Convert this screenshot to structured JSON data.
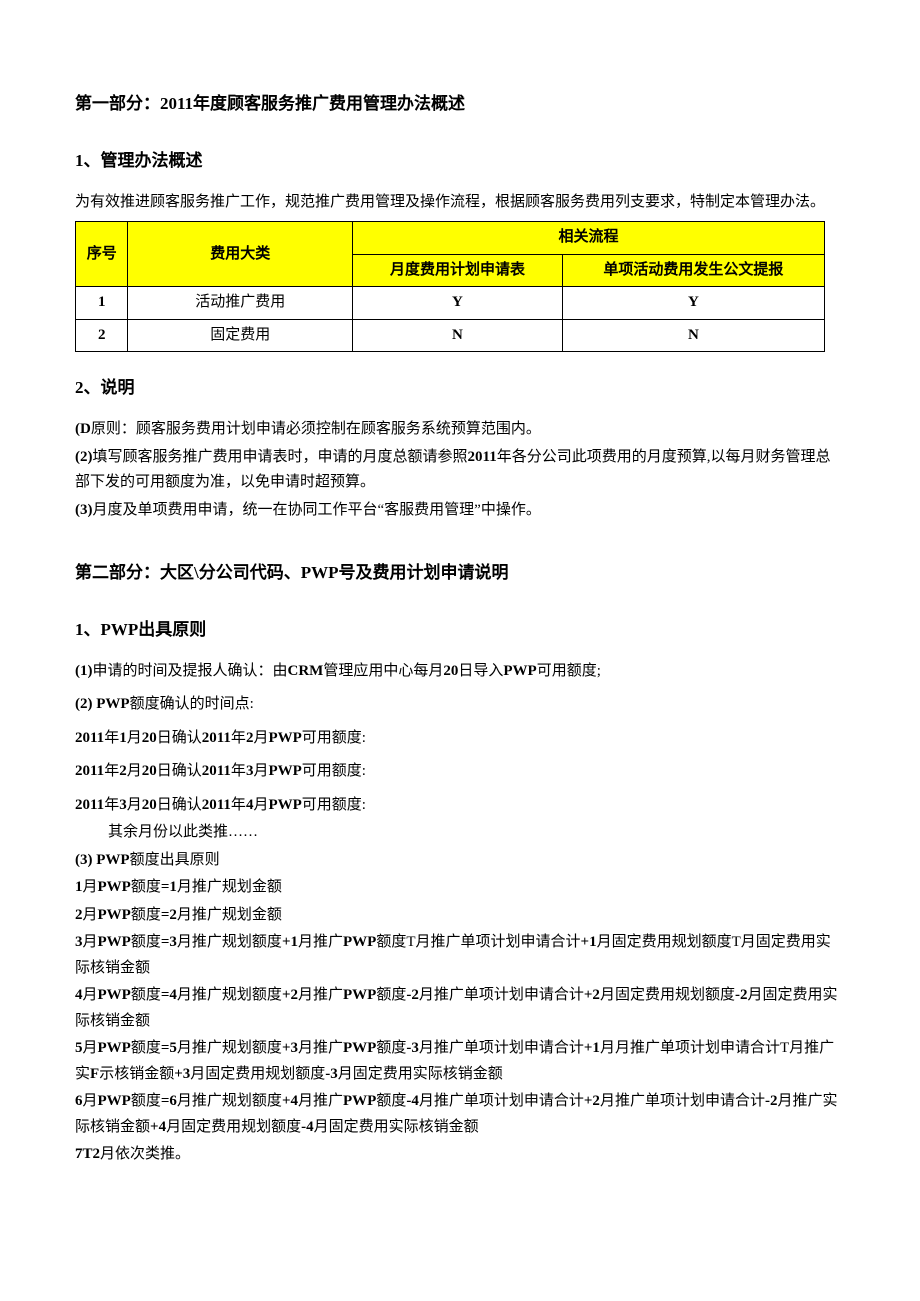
{
  "part1": {
    "title": "第一部分：2011年度顾客服务推广费用管理办法概述",
    "s1_heading": "1、管理办法概述",
    "intro": "为有效推进顾客服务推广工作，规范推广费用管理及操作流程，根据顾客服务费用列支要求，特制定本管理办法。",
    "table": {
      "h_seq": "序号",
      "h_cat": "费用大类",
      "h_flow": "相关流程",
      "h_flow1": "月度费用计划申请表",
      "h_flow2": "单项活动费用发生公文提报",
      "rows": [
        {
          "n": "1",
          "cat": "活动推广费用",
          "c1": "Y",
          "c2": "Y"
        },
        {
          "n": "2",
          "cat": "固定费用",
          "c1": "N",
          "c2": "N"
        }
      ]
    },
    "s2_heading": "2、说明",
    "note1_b": "(D",
    "note1": "原则：顾客服务费用计划申请必须控制在顾客服务系统预算范围内。",
    "note2_b": "(2)",
    "note2a": "填写顾客服务推广费用申请表时，申请的月度总额请参照",
    "note2_mid": "2011",
    "note2b": "年各分公司此项费用的月度预算,以每月财务管理总部下发的可用额度为准，以免申请时超预算。",
    "note3_b": "(3)",
    "note3": "月度及单项费用申请，统一在协同工作平台“客服费用管理”中操作。"
  },
  "part2": {
    "title_a": "第二部分：大区\\分公司代码、",
    "title_b": "PWP",
    "title_c": "号及费用计划申请说明",
    "s1_heading": "1、PWP出具原则",
    "p1_b": "(1)",
    "p1a": "申请的时间及提报人确认：由",
    "p1_mid": "CRM",
    "p1b": "管理应用中心每月",
    "p1_mid2": "20",
    "p1c": "日导入",
    "p1_mid3": "PWP",
    "p1d": "可用额度;",
    "p2_b": "(2)    PWP",
    "p2": "额度确认的时间点:",
    "d1_b": "2011",
    "d1a": "年",
    "d1_b2": "1",
    "d1b": "月",
    "d1_b3": "20",
    "d1c": "日确认",
    "d1_b4": "2011",
    "d1d": "年",
    "d1_b5": "2",
    "d1e": "月",
    "d1_b6": "PWP",
    "d1f": "可用额度:",
    "d2_b": "2011",
    "d2a": "年",
    "d2_b2": "2",
    "d2b": "月",
    "d2_b3": "20",
    "d2c": "日确认",
    "d2_b4": "2011",
    "d2d": "年",
    "d2_b5": "3",
    "d2e": "月",
    "d2_b6": "PWP",
    "d2f": "可用额度:",
    "d3_b": "2011",
    "d3a": "年",
    "d3_b2": "3",
    "d3b": "月",
    "d3_b3": "20",
    "d3c": "日确认",
    "d3_b4": "2011",
    "d3d": "年",
    "d3_b5": "4",
    "d3e": "月",
    "d3_b6": "PWP",
    "d3f": "可用额度:",
    "rest": "其余月份以此类推……",
    "p3_b": "(3)    PWP",
    "p3": "额度出具原则",
    "f1_b1": "1",
    "f1a": "月",
    "f1_b2": "PWP",
    "f1b": "额度",
    "f1_b3": "=1",
    "f1c": "月推广规划金额",
    "f2_b1": "2",
    "f2a": "月",
    "f2_b2": "PWP",
    "f2b": "额度",
    "f2_b3": "=2",
    "f2c": "月推广规划金额",
    "f3_b1": "3",
    "f3a": "月",
    "f3_b2": "PWP",
    "f3b": "额度",
    "f3_b3": "=3",
    "f3c": "月推广规划额度",
    "f3_b4": "+1",
    "f3d": "月推广",
    "f3_b5": "PWP",
    "f3e": "额度T月推广单项计划申请合计",
    "f3_b6": "+1",
    "f3f": "月固定费用规划额度T月固定费用实际核销金额",
    "f4_b1": "4",
    "f4a": "月",
    "f4_b2": "PWP",
    "f4b": "额度",
    "f4_b3": "=4",
    "f4c": "月推广规划额度",
    "f4_b4": "+2",
    "f4d": "月推广",
    "f4_b5": "PWP",
    "f4e": "额度",
    "f4_b6": "-2",
    "f4f": "月推广单项计划申请合计",
    "f4_b7": "+2",
    "f4g": "月固定费用规划额度",
    "f4_b8": "-2",
    "f4h": "月固定费用实际核销金额",
    "f5_b1": "5",
    "f5a": "月",
    "f5_b2": "PWP",
    "f5b": "额度",
    "f5_b3": "=5",
    "f5c": "月推广规划额度",
    "f5_b4": "+3",
    "f5d": "月推广",
    "f5_b5": "PWP",
    "f5e": "额度",
    "f5_b6": "-3",
    "f5f": "月推广单项计划申请合计",
    "f5_b7": "+1",
    "f5g": "月月推广单项计划申请合计T月推广实",
    "f5_b8": "F",
    "f5h": "示核销金额",
    "f5_b9": "+3",
    "f5i": "月固定费用规划额度",
    "f5_b10": "-3",
    "f5j": "月固定费用实际核销金额",
    "f6_b1": "6",
    "f6a": "月",
    "f6_b2": "PWP",
    "f6b": "额度",
    "f6_b3": "=6",
    "f6c": "月推广规划额度",
    "f6_b4": "+4",
    "f6d": "月推广",
    "f6_b5": "PWP",
    "f6e": "额度",
    "f6_b6": "-4",
    "f6f": "月推广单项计划申请合计",
    "f6_b7": "+2",
    "f6g": "月推广单项计划申请合计",
    "f6_b8": "-2",
    "f6h": "月推广实际核销金额",
    "f6_b9": "+4",
    "f6i": "月固定费用规划额度",
    "f6_b10": "-4",
    "f6j": "月固定费用实际核销金额",
    "f7_b": "7T2",
    "f7": "月依次类推。"
  }
}
